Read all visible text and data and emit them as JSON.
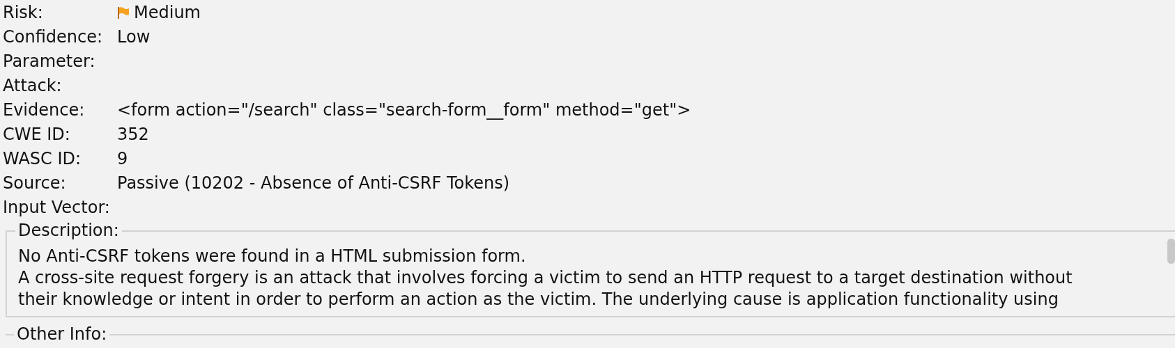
{
  "fields": [
    {
      "label": "Risk:",
      "value": "Medium",
      "kind": "flag"
    },
    {
      "label": "Confidence:",
      "value": "Low",
      "kind": "text"
    },
    {
      "label": "Parameter:",
      "kind": "text"
    },
    {
      "label": "Attack:",
      "kind": "text"
    },
    {
      "label": "Evidence:",
      "value": "<form action=\"/search\" class=\"search-form__form\" method=\"get\">",
      "kind": "text"
    },
    {
      "label": "CWE ID:",
      "value": "352",
      "kind": "text"
    },
    {
      "label": "WASC ID:",
      "value": "9",
      "kind": "text"
    },
    {
      "label": "Source:",
      "value": "Passive (10202 - Absence of Anti-CSRF Tokens)",
      "kind": "text"
    },
    {
      "label": "Input Vector:",
      "kind": "text"
    }
  ],
  "description": {
    "title": "Description:",
    "lines": [
      "No Anti-CSRF tokens were found in a HTML submission form.",
      "A cross-site request forgery is an attack that involves forcing a victim to send an HTTP request to a target destination without",
      "their knowledge or intent in order to perform an action as the victim. The underlying cause is application functionality using"
    ]
  },
  "other_info": {
    "title": "Other Info:"
  }
}
